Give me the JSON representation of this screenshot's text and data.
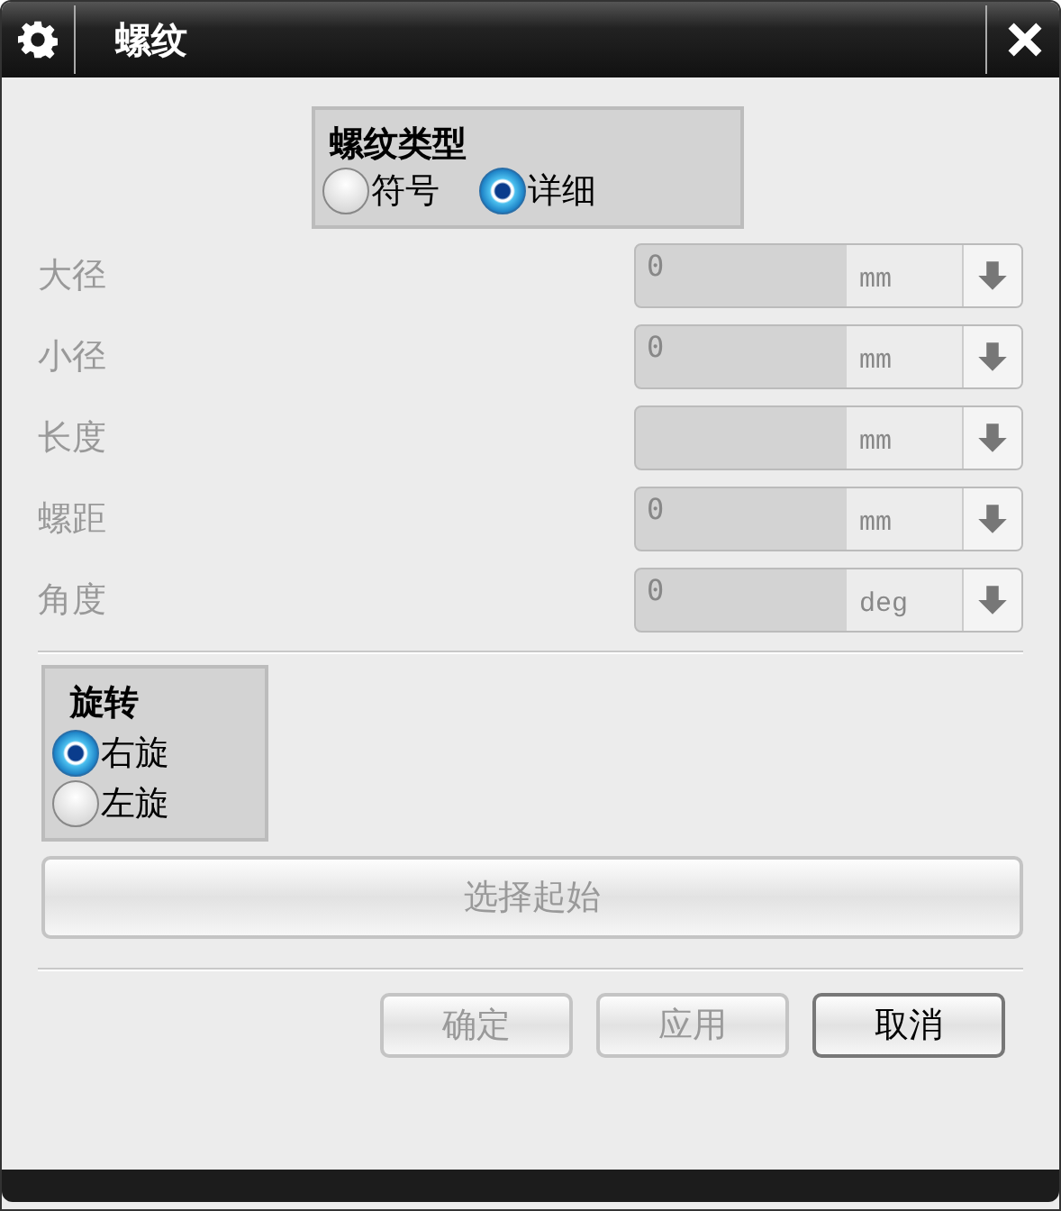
{
  "window": {
    "title": "螺纹"
  },
  "thread_type": {
    "title": "螺纹类型",
    "options": [
      {
        "label": "符号",
        "selected": false
      },
      {
        "label": "详细",
        "selected": true
      }
    ]
  },
  "fields": [
    {
      "label": "大径",
      "value": "0",
      "unit": "mm",
      "disabled": true
    },
    {
      "label": "小径",
      "value": "0",
      "unit": "mm",
      "disabled": true
    },
    {
      "label": "长度",
      "unit": "mm",
      "disabled": true
    },
    {
      "label": "螺距",
      "value": "0",
      "unit": "mm",
      "disabled": true
    },
    {
      "label": "角度",
      "value": "0",
      "unit": "deg",
      "disabled": true
    }
  ],
  "rotation": {
    "title": "旋转",
    "options": [
      {
        "label": "右旋",
        "selected": true
      },
      {
        "label": "左旋",
        "selected": false
      }
    ]
  },
  "select_button": {
    "label": "选择起始",
    "disabled": true
  },
  "buttons": [
    {
      "label": "确定",
      "disabled": true
    },
    {
      "label": "应用",
      "disabled": true
    },
    {
      "label": "取消",
      "disabled": false
    }
  ]
}
